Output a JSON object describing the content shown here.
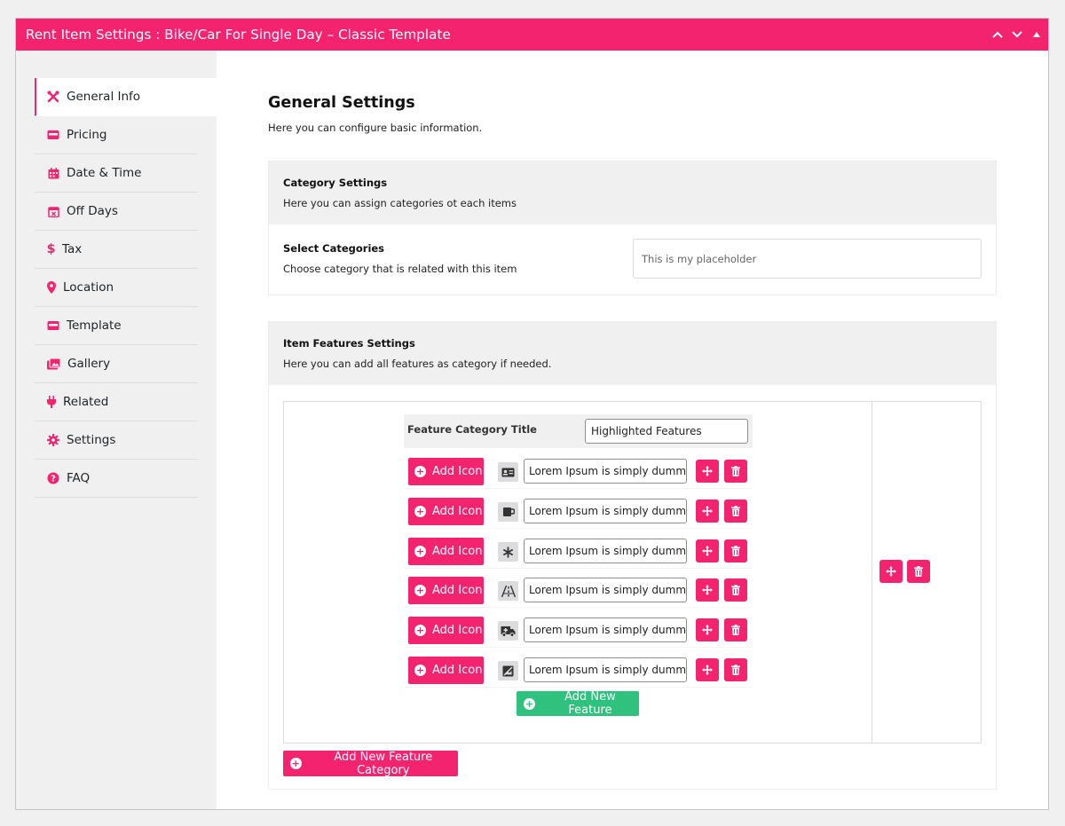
{
  "window": {
    "title": "Rent Item Settings : Bike/Car For Single Day – Classic Template",
    "controls": [
      "chevron-up-icon",
      "chevron-down-icon",
      "triangle-up-icon"
    ]
  },
  "colors": {
    "accent": "#f3236f",
    "success": "#2ec27e",
    "sidebar_bg": "#f0f0f1"
  },
  "sidebar": {
    "items": [
      {
        "label": "General Info",
        "icon": "tools-icon",
        "active": true
      },
      {
        "label": "Pricing",
        "icon": "card-icon"
      },
      {
        "label": "Date & Time",
        "icon": "calendar-icon"
      },
      {
        "label": "Off Days",
        "icon": "calendar-x-icon"
      },
      {
        "label": "Tax",
        "icon": "dollar-icon"
      },
      {
        "label": "Location",
        "icon": "map-pin-icon"
      },
      {
        "label": "Template",
        "icon": "card-icon"
      },
      {
        "label": "Gallery",
        "icon": "images-icon"
      },
      {
        "label": "Related",
        "icon": "plug-icon"
      },
      {
        "label": "Settings",
        "icon": "gear-icon"
      },
      {
        "label": "FAQ",
        "icon": "question-icon"
      }
    ]
  },
  "main": {
    "title": "General Settings",
    "subtitle": "Here you can configure basic information.",
    "category": {
      "title": "Category Settings",
      "desc": "Here you can assign categories ot each items",
      "select_title": "Select Categories",
      "select_desc": "Choose category that is related with this item",
      "placeholder": "This is my placeholder"
    },
    "features": {
      "title": "Item Features Settings",
      "desc": "Here you can add all features as category if needed.",
      "category_title_label": "Feature Category Title",
      "category_title_value": "Highlighted Features",
      "add_icon_label": "Add Icon",
      "rows": [
        {
          "icon": "id-card-icon",
          "text": "Lorem Ipsum is simply dummy text"
        },
        {
          "icon": "mug-icon",
          "text": "Lorem Ipsum is simply dummy text"
        },
        {
          "icon": "asterisk-icon",
          "text": "Lorem Ipsum is simply dummy text"
        },
        {
          "icon": "road-icon",
          "text": "Lorem Ipsum is simply dummy text"
        },
        {
          "icon": "ambulance-icon",
          "text": "Lorem Ipsum is simply dummy text"
        },
        {
          "icon": "image-off-icon",
          "text": "Lorem Ipsum is simply dummy text"
        }
      ],
      "add_feature_label": "Add New Feature",
      "add_category_label": "Add New Feature Category"
    }
  }
}
